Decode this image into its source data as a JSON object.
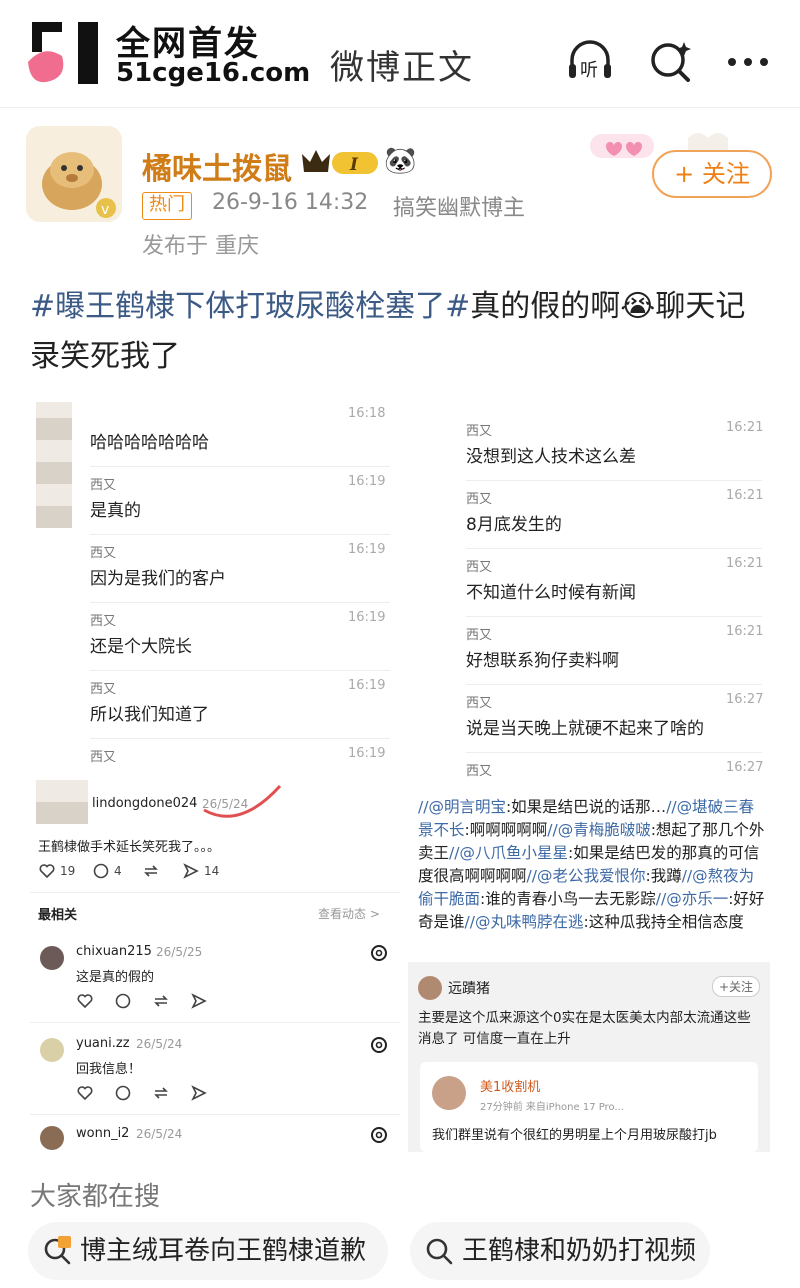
{
  "header": {
    "brand_line1": "全网首发",
    "brand_line2": "51cge16.com",
    "title": "微博正文",
    "listen_label": "听"
  },
  "post": {
    "author": "橘味土拨鼠",
    "vip_level": "I",
    "hot_tag": "热门",
    "time": "26-9-16 14:32",
    "role": "搞笑幽默博主",
    "location": "发布于 重庆",
    "follow_label": "+ 关注",
    "hashtag1": "#曝王鹤棣下体打玻尿酸栓塞了#",
    "hashtag2": "真的假的啊",
    "text_rest": "聊天记录笑死我了"
  },
  "chat_left": [
    {
      "sender": "",
      "time": "16:18",
      "text": "哈哈哈哈哈哈哈"
    },
    {
      "sender": "西又",
      "time": "16:19",
      "text": "是真的"
    },
    {
      "sender": "西又",
      "time": "16:19",
      "text": "因为是我们的客户"
    },
    {
      "sender": "西又",
      "time": "16:19",
      "text": "还是个大院长"
    },
    {
      "sender": "西又",
      "time": "16:19",
      "text": "所以我们知道了"
    },
    {
      "sender": "西又",
      "time": "16:19",
      "text": ""
    }
  ],
  "chat_right": [
    {
      "sender": "西又",
      "time": "16:21",
      "text": "没想到这人技术这么差"
    },
    {
      "sender": "西又",
      "time": "16:21",
      "text": "8月底发生的"
    },
    {
      "sender": "西又",
      "time": "16:21",
      "text": "不知道什么时候有新闻"
    },
    {
      "sender": "西又",
      "time": "16:21",
      "text": "好想联系狗仔卖料啊"
    },
    {
      "sender": "西又",
      "time": "16:27",
      "text": "说是当天晚上就硬不起来了啥的"
    },
    {
      "sender": "西又",
      "time": "16:27",
      "text": ""
    }
  ],
  "comments": {
    "main_user": "lindongdone024",
    "main_date": "26/5/24",
    "main_text": "王鹤棣做手术延长笑死我了。。。",
    "likes": "19",
    "replies": "4",
    "shares": "14",
    "sort_label": "最相关",
    "view_label": "查看动态 >",
    "items": [
      {
        "user": "chixuan215",
        "date": "26/5/25",
        "text": "这是真的假的"
      },
      {
        "user": "yuani.zz",
        "date": "26/5/24",
        "text": "回我信息！"
      },
      {
        "user": "wonn_i2",
        "date": "26/5/24",
        "text": ""
      }
    ]
  },
  "right_repost": {
    "seg1_at": "//@明言明宝",
    "seg1": ":如果是结巴说的话那…",
    "seg2_at": "//@堪破三春景不长",
    "seg2": ":啊啊啊啊啊",
    "seg3_at": "//@青梅脆啵啵",
    "seg3": ":想起了那几个外卖王",
    "seg4_at": "//@八爪鱼小星星",
    "seg4": ":如果是结巴发的那真的可信度很高啊啊啊啊",
    "seg5_at": "//@老公我爱恨你",
    "seg5": ":我蹲",
    "seg6_at": "//@熬夜为偷干脆面",
    "seg6": ":谁的青春小鸟一去无影踪",
    "seg7_at": "//@亦乐一",
    "seg7": ":好好奇是谁",
    "seg8_at": "//@丸味鸭脖在逃",
    "seg8": ":这种瓜我持全相信态度"
  },
  "right_card": {
    "user": "远蹟猪",
    "follow": "+关注",
    "text": "主要是这个瓜来源这个0实在是太医美太内部太流通这些消息了 可信度一直在上升",
    "inner_user": "美1收割机",
    "inner_meta": "27分钟前  来自iPhone 17 Pro...",
    "inner_text": "我们群里说有个很红的男明星上个月用玻尿酸打jb"
  },
  "trending": {
    "title": "大家都在搜",
    "chip1": "博主绒耳卷向王鹤棣道歉",
    "chip2": "王鹤棣和奶奶打视频"
  },
  "colors": {
    "accent_orange": "#ef7f14",
    "hashtag_blue": "#3c5a86",
    "at_blue": "#3e6aa6",
    "logo_pink": "#f06d8f"
  }
}
